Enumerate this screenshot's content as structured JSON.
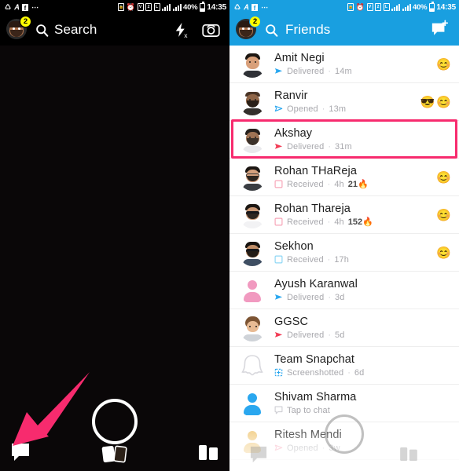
{
  "status_bar": {
    "time": "14:35",
    "battery_percent": "40%",
    "left_icons": [
      "sync-icon",
      "twitter-icon",
      "facebook-icon",
      "more-icon"
    ],
    "right_icons": [
      "lock-icon",
      "alarm-icon",
      "volte-icon",
      "sim-icon",
      "lte-icon",
      "signal-icon",
      "signal2-icon"
    ]
  },
  "left_panel": {
    "name": "camera-screen",
    "header": {
      "search_label": "Search",
      "avatar_badge": "2",
      "flash_icon": "flash-off-icon",
      "camera_flip_icon": "camera-flip-icon",
      "search_icon": "search-icon"
    },
    "bottom_bar": {
      "chat_icon": "chat-bubble-icon",
      "shutter": "shutter-button",
      "memories_icon": "memories-icon",
      "stories_icon": "stories-icon"
    },
    "annotation": {
      "type": "arrow",
      "color": "#f72b6e",
      "points_to": "chat-bubble-icon"
    }
  },
  "right_panel": {
    "name": "friends-screen",
    "header": {
      "title": "Friends",
      "avatar_badge": "2",
      "search_icon": "search-icon",
      "new_chat_icon": "new-chat-icon",
      "background_color": "#199fe0"
    },
    "highlight": {
      "target": "Akshay",
      "color": "#f72b6e"
    },
    "friends": [
      {
        "name": "Amit Negi",
        "status": "Delivered",
        "status_type": "delivered-filled",
        "status_color": "#2aa7ef",
        "time": "14m",
        "streak": "",
        "emojis": [
          "😊"
        ],
        "avatar": "bitmoji-amit",
        "highlighted": false
      },
      {
        "name": "Ranvir",
        "status": "Opened",
        "status_type": "opened-outline",
        "status_color": "#2aa7ef",
        "time": "13m",
        "streak": "",
        "emojis": [
          "😎",
          "😊"
        ],
        "avatar": "bitmoji-ranvir",
        "highlighted": false
      },
      {
        "name": "Akshay",
        "status": "Delivered",
        "status_type": "delivered-filled",
        "status_color": "#f23b55",
        "time": "31m",
        "streak": "",
        "emojis": [],
        "avatar": "bitmoji-akshay",
        "highlighted": true
      },
      {
        "name": "Rohan THaReja",
        "status": "Received",
        "status_type": "received-square-outline",
        "status_color": "#f7a6b8",
        "time": "4h",
        "streak": "21",
        "streak_emoji": "🔥",
        "emojis": [
          "😊"
        ],
        "avatar": "bitmoji-rohan1",
        "highlighted": false
      },
      {
        "name": "Rohan Thareja",
        "status": "Received",
        "status_type": "received-square-outline",
        "status_color": "#f7a6b8",
        "time": "4h",
        "streak": "152",
        "streak_emoji": "🔥",
        "emojis": [
          "😊"
        ],
        "avatar": "bitmoji-rohan2",
        "highlighted": false
      },
      {
        "name": "Sekhon",
        "status": "Received",
        "status_type": "received-square-outline",
        "status_color": "#8fd7f5",
        "time": "17h",
        "streak": "",
        "emojis": [
          "😊"
        ],
        "avatar": "bitmoji-sekhon",
        "highlighted": false
      },
      {
        "name": "Ayush Karanwal",
        "status": "Delivered",
        "status_type": "delivered-filled",
        "status_color": "#2aa7ef",
        "time": "3d",
        "streak": "",
        "emojis": [],
        "avatar": "placeholder-pink",
        "highlighted": false
      },
      {
        "name": "GGSC",
        "status": "Delivered",
        "status_type": "delivered-filled",
        "status_color": "#f23b55",
        "time": "5d",
        "streak": "",
        "emojis": [],
        "avatar": "bitmoji-ggsc",
        "highlighted": false
      },
      {
        "name": "Team Snapchat",
        "status": "Screenshotted",
        "status_type": "screenshotted",
        "status_color": "#2aa7ef",
        "time": "6d",
        "streak": "",
        "emojis": [],
        "avatar": "ghost-icon",
        "highlighted": false
      },
      {
        "name": "Shivam Sharma",
        "status": "Tap to chat",
        "status_type": "chat-square-outline",
        "status_color": "#cfcfd4",
        "time": "",
        "streak": "",
        "emojis": [],
        "avatar": "placeholder-blue",
        "highlighted": false
      },
      {
        "name": "Ritesh Mendi",
        "status": "Opened",
        "status_type": "opened-outline",
        "status_color": "#f7a6b8",
        "time": "3w",
        "streak": "",
        "emojis": [],
        "avatar": "placeholder-yellow",
        "highlighted": false
      }
    ],
    "bottom_overlay": {
      "chat_icon": "chat-bubble-icon",
      "shutter": "shutter-button",
      "stories_icon": "stories-icon"
    }
  }
}
